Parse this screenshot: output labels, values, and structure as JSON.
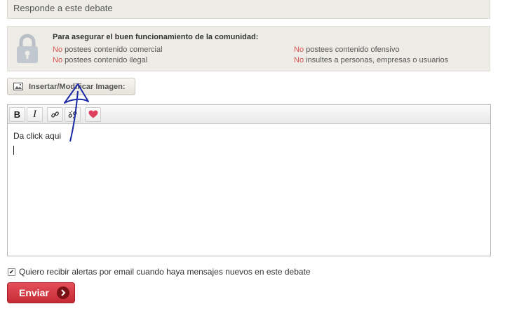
{
  "header": {
    "title": "Responde a este debate"
  },
  "rules": {
    "title": "Para asegurar el buen funcionamiento de la comunidad:",
    "no_word": "No",
    "items": [
      " postees contenido comercial",
      " postees contenido ilegal",
      " postees contenido ofensivo",
      " insultes a personas, empresas o usuarios"
    ],
    "no_color": "#d9534f"
  },
  "insert_image": {
    "label": "Insertar/Modificar Imagen:"
  },
  "toolbar": {
    "bold": "B",
    "italic": "I"
  },
  "editor": {
    "content": "Da click  aqui"
  },
  "alerts": {
    "checked": true,
    "label": "Quiero recibir alertas por email cuando haya mensajes nuevos en este debate"
  },
  "send": {
    "label": "Enviar"
  },
  "colors": {
    "accent": "#c52a34",
    "panel": "#eeece6",
    "annotation": "#1c2aa8"
  }
}
